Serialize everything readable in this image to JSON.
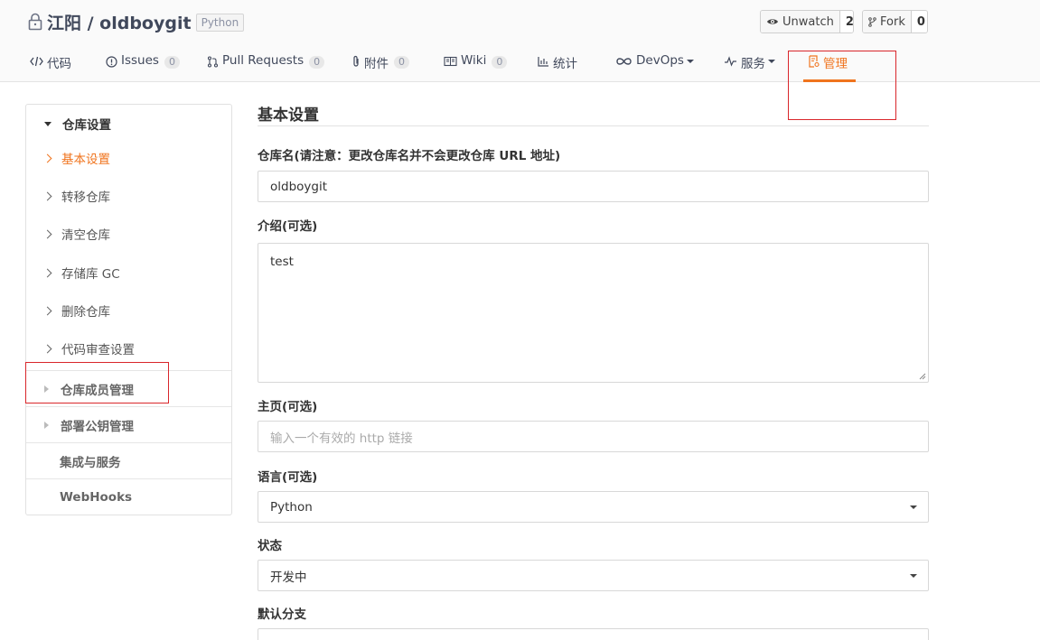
{
  "repo": {
    "title": "江阳 / oldboygit",
    "language_badge": "Python"
  },
  "actions": {
    "watch_label": "Unwatch",
    "watch_count": "2",
    "fork_label": "Fork",
    "fork_count": "0"
  },
  "tabs": [
    {
      "label": "代码",
      "icon": "code-icon"
    },
    {
      "label": "Issues",
      "badge": "0",
      "icon": "issue-icon"
    },
    {
      "label": "Pull Requests",
      "badge": "0",
      "icon": "pull-request-icon"
    },
    {
      "label": "附件",
      "badge": "0",
      "icon": "paperclip-icon"
    },
    {
      "label": "Wiki",
      "badge": "0",
      "icon": "book-icon"
    },
    {
      "label": "统计",
      "icon": "bar-chart-icon"
    },
    {
      "label": "DevOps",
      "icon": "infinity-icon"
    },
    {
      "label": "服务",
      "icon": "pulse-icon"
    },
    {
      "label": "管理",
      "icon": "settings-doc-icon",
      "active": true
    }
  ],
  "sidebar": {
    "group_title": "仓库设置",
    "items": [
      {
        "label": "基本设置",
        "active": true
      },
      {
        "label": "转移仓库"
      },
      {
        "label": "清空仓库"
      },
      {
        "label": "存储库 GC"
      },
      {
        "label": "删除仓库"
      },
      {
        "label": "代码审查设置"
      }
    ],
    "rows": [
      {
        "label": "仓库成员管理"
      },
      {
        "label": "部署公钥管理"
      },
      {
        "label": "集成与服务"
      },
      {
        "label": "WebHooks"
      }
    ]
  },
  "form": {
    "title": "基本设置",
    "name_label": "仓库名(请注意：更改仓库名并不会更改仓库 URL 地址)",
    "name_value": "oldboygit",
    "desc_label": "介绍(可选)",
    "desc_value": "test",
    "homepage_label": "主页(可选)",
    "homepage_placeholder": "输入一个有效的 http 链接",
    "language_label": "语言(可选)",
    "language_value": "Python",
    "status_label": "状态",
    "status_value": "开发中",
    "branch_label": "默认分支"
  },
  "colors": {
    "accent": "#f0741e",
    "highlight_box": "#d9262b"
  }
}
